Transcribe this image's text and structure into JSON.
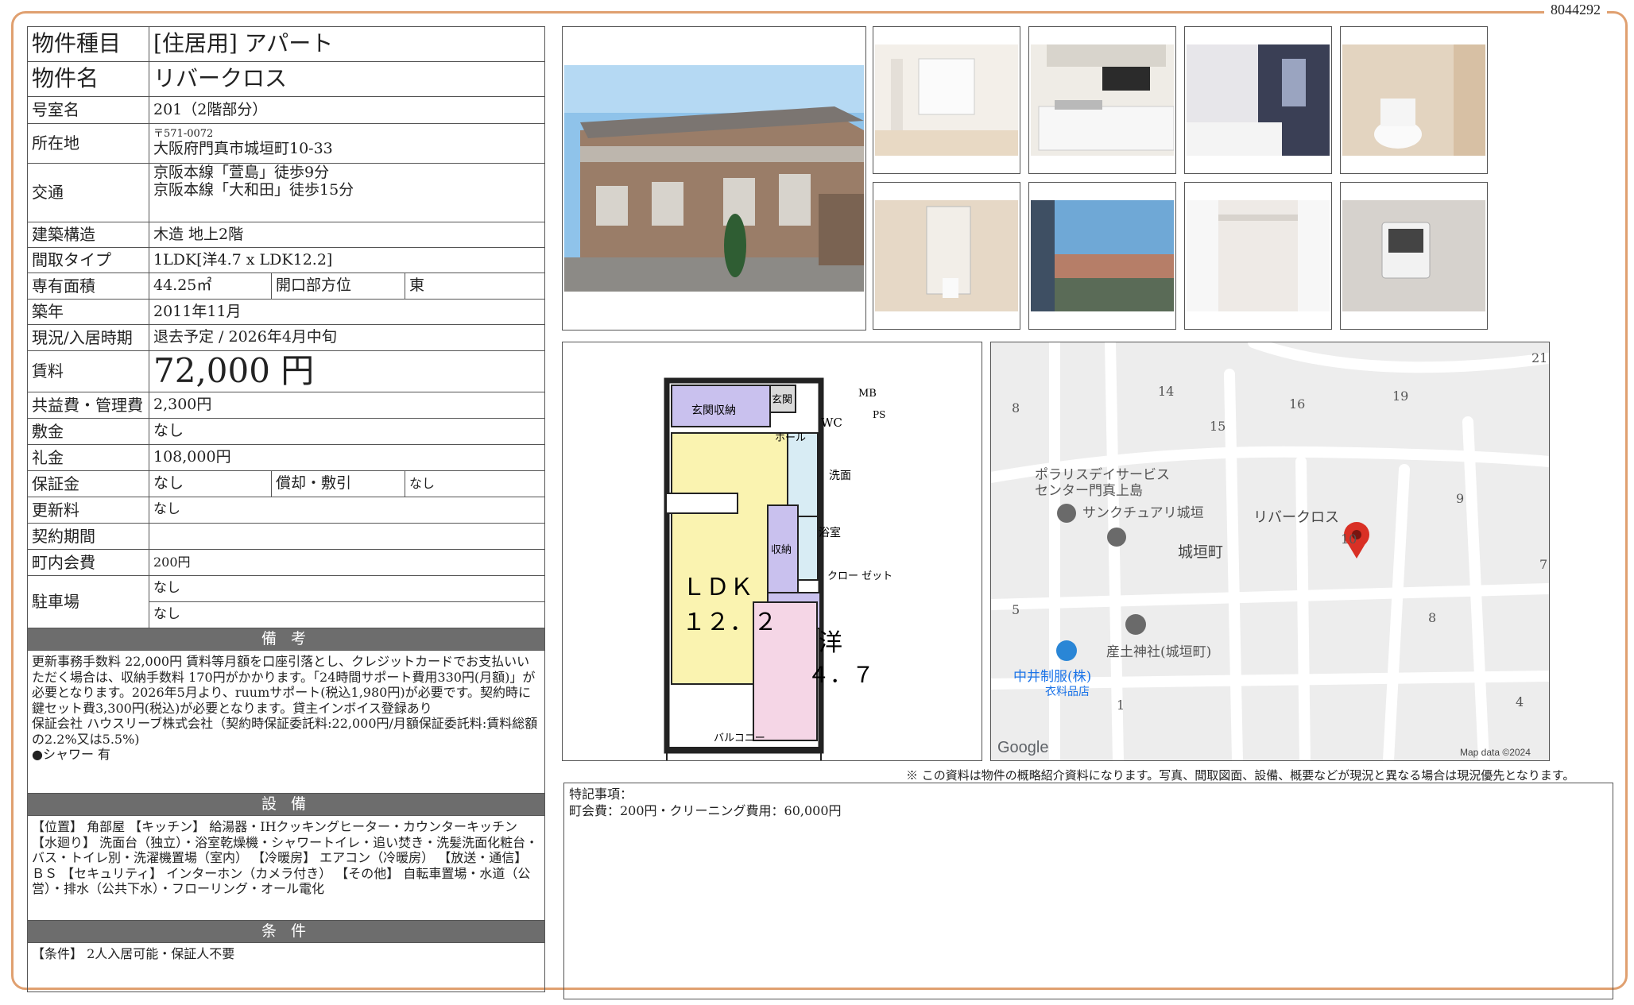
{
  "doc_id": "8044292",
  "spec": {
    "type_label": "物件種目",
    "type_value": "[住居用] アパート",
    "name_label": "物件名",
    "name_value": "リバークロス",
    "room_label": "号室名",
    "room_value": "201（2階部分）",
    "address_label": "所在地",
    "postal": "〒571-0072",
    "address_value": "大阪府門真市城垣町10-33",
    "access_label": "交通",
    "access_1": "京阪本線「萱島」徒歩9分",
    "access_2": "京阪本線「大和田」徒歩15分",
    "structure_label": "建築構造",
    "structure_value": "木造 地上2階",
    "layout_label": "間取タイプ",
    "layout_value": "1LDK[洋4.7 x LDK12.2]",
    "area_label": "専有面積",
    "area_value": "44.25㎡",
    "direction_label": "開口部方位",
    "direction_value": "東",
    "built_label": "築年",
    "built_value": "2011年11月",
    "status_label": "現況/入居時期",
    "status_value": "退去予定 / 2026年4月中旬",
    "rent_label": "賃料",
    "rent_value": "72,000 円",
    "fee_label": "共益費・管理費",
    "fee_value": "2,300円",
    "deposit_label": "敷金",
    "deposit_value": "なし",
    "keymoney_label": "礼金",
    "keymoney_value": "108,000円",
    "guarantee_label": "保証金",
    "guarantee_value": "なし",
    "amort_label": "償却・敷引",
    "amort_value": "なし",
    "renewal_label": "更新料",
    "renewal_value": "なし",
    "contract_label": "契約期間",
    "contract_value": "",
    "town_label": "町内会費",
    "town_value": "200円",
    "parking_label": "駐車場",
    "parking_1": "なし",
    "parking_2": "なし"
  },
  "sections": {
    "remarks_title": "備 考",
    "remarks_text": "更新事務手数料 22,000円 賃料等月額を口座引落とし、クレジットカードでお支払いいただく場合は、収納手数料 170円がかかります。「24時間サポート費用330円(月額)」が必要となります。2026年5月より、ruumサポート(税込1,980円)が必要です。契約時に鍵セット費3,300円(税込)が必要となります。貸主インボイス登録あり",
    "guarantor_text": "保証会社 ハウスリーブ株式会社（契約時保証委託料:22,000円/月額保証委託料:賃料総額の2.2%又は5.5%)",
    "shower_text": "●シャワー 有",
    "equip_title": "設 備",
    "equip_text": "【位置】 角部屋 【キッチン】 給湯器・IHクッキングヒーター・カウンターキッチン 【水廻り】 洗面台（独立）・浴室乾燥機・シャワートイレ・追い焚き・洗髪洗面化粧台・バス・トイレ別・洗濯機置場（室内） 【冷暖房】 エアコン（冷暖房） 【放送・通信】 ＢＳ 【セキュリティ】 インターホン（カメラ付き） 【その他】 自転車置場・水道（公営）・排水（公共下水）・フローリング・オール電化",
    "cond_title": "条 件",
    "cond_text": "【条件】 2人入居可能・保証人不要"
  },
  "floorplan": {
    "entrance_storage": "玄関収納",
    "entrance": "玄関",
    "hall": "ホール",
    "wc": "WC",
    "mb": "MB",
    "ps": "PS",
    "washroom": "洗面",
    "bath": "浴室",
    "storage": "収納",
    "closet": "クロー ゼット",
    "ldk": "ＬＤＫ",
    "ldk_size": "１２．２",
    "western": "洋",
    "western_size": "４．７",
    "balcony": "バルコニー"
  },
  "map": {
    "labels": [
      "ポラリスデイサービス",
      "センター門真上島",
      "サンクチュアリ城垣",
      "リバークロス",
      "城垣町",
      "産土神社(城垣町)",
      "中井制服(株)",
      "衣料品店"
    ],
    "numbers": [
      "8",
      "14",
      "15",
      "16",
      "19",
      "21",
      "9",
      "7",
      "10",
      "5",
      "8",
      "1",
      "4"
    ],
    "google": "Google",
    "mapdata": "Map data ©2024",
    "pin_color": "#d93025"
  },
  "notice": "※ この資料は物件の概略紹介資料になります。写真、間取図面、設備、概要などが現況と異なる場合は現況優先となります。",
  "special": {
    "title": "特記事項：",
    "text": "町会費：200円・クリーニング費用：60,000円"
  }
}
